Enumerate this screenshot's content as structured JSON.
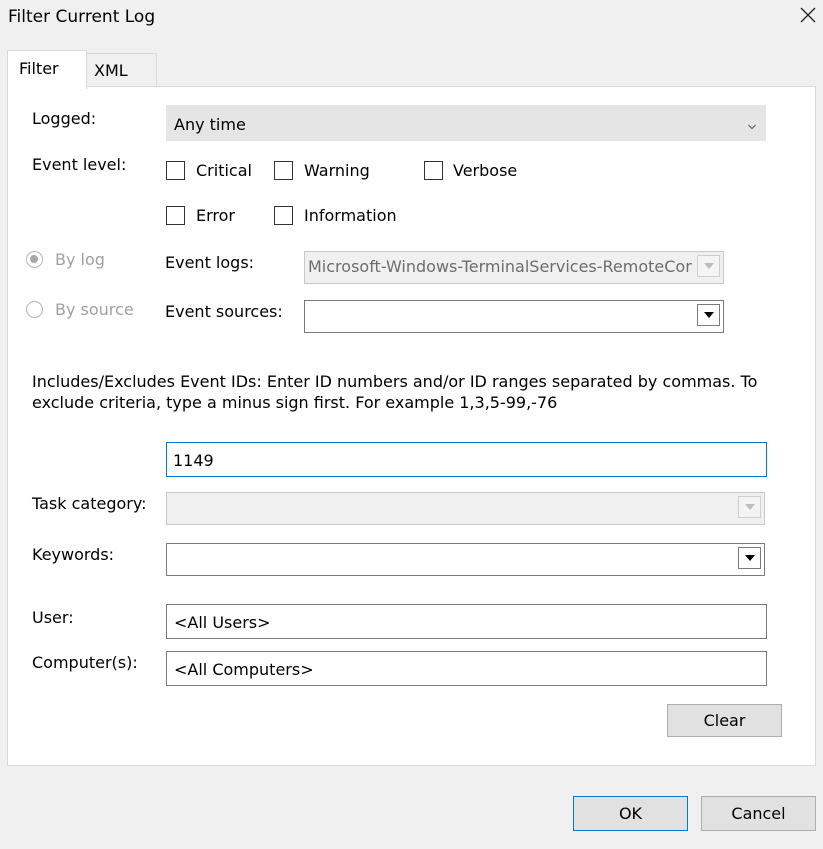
{
  "window": {
    "title": "Filter Current Log"
  },
  "tabs": [
    {
      "label": "Filter"
    },
    {
      "label": "XML"
    }
  ],
  "filter": {
    "logged": {
      "label": "Logged:",
      "value": "Any time"
    },
    "event_level": {
      "label": "Event level:",
      "options": [
        {
          "label": "Critical",
          "checked": false
        },
        {
          "label": "Warning",
          "checked": false
        },
        {
          "label": "Verbose",
          "checked": false
        },
        {
          "label": "Error",
          "checked": false
        },
        {
          "label": "Information",
          "checked": false
        }
      ]
    },
    "by_log": {
      "label": "By log",
      "selected": true
    },
    "by_source": {
      "label": "By source",
      "selected": false
    },
    "event_logs": {
      "label": "Event logs:",
      "value": "Microsoft-Windows-TerminalServices-RemoteConnectionManager/Operational"
    },
    "event_sources": {
      "label": "Event sources:",
      "value": ""
    },
    "event_ids": {
      "description": "Includes/Excludes Event IDs: Enter ID numbers and/or ID ranges separated by commas. To exclude criteria, type a minus sign first. For example 1,3,5-99,-76",
      "value": "1149"
    },
    "task_category": {
      "label": "Task category:",
      "value": ""
    },
    "keywords": {
      "label": "Keywords:",
      "value": ""
    },
    "user": {
      "label": "User:",
      "value": "<All Users>"
    },
    "computers": {
      "label": "Computer(s):",
      "value": "<All Computers>"
    },
    "clear_label": "Clear"
  },
  "footer": {
    "ok_label": "OK",
    "cancel_label": "Cancel"
  },
  "colors": {
    "focus_border": "#0078d7",
    "disabled_text": "#a0a0a0"
  }
}
